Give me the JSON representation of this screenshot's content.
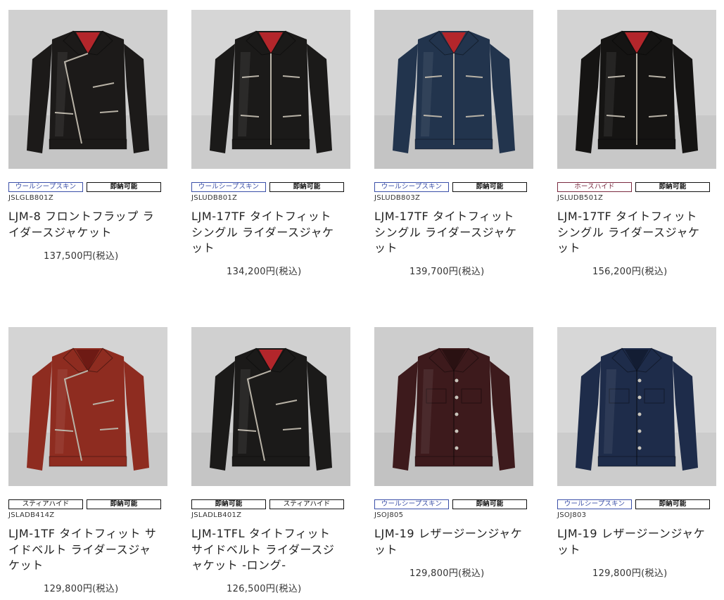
{
  "products": [
    {
      "tag1": "ウールシープスキン",
      "tag2": "即納可能",
      "sku": "JSLGLB801Z",
      "title": "LJM-8 フロントフラップ ライダースジャケット",
      "price": "137,500円(税込)",
      "jacket_color": "#1c1a19",
      "lining_color": "#b3262b",
      "photo_bg": "#d0d0d0"
    },
    {
      "tag1": "ウールシープスキン",
      "tag2": "即納可能",
      "sku": "JSLUDB801Z",
      "title": "LJM-17TF タイトフィット シングル ライダースジャケット",
      "price": "134,200円(税込)",
      "jacket_color": "#1b1a19",
      "lining_color": "#b3262b",
      "photo_bg": "#d6d6d6"
    },
    {
      "tag1": "ウールシープスキン",
      "tag2": "即納可能",
      "sku": "JSLUDB803Z",
      "title": "LJM-17TF タイトフィット シングル ライダースジャケット",
      "price": "139,700円(税込)",
      "jacket_color": "#22344d",
      "lining_color": "#b3262b",
      "photo_bg": "#cfcfcf"
    },
    {
      "tag1": "ホースハイド",
      "tag2": "即納可能",
      "sku": "JSLUDB501Z",
      "title": "LJM-17TF タイトフィット シングル ライダースジャケット",
      "price": "156,200円(税込)",
      "jacket_color": "#151413",
      "lining_color": "#b3262b",
      "photo_bg": "#d3d3d3"
    },
    {
      "tag1": "スティアハイド",
      "tag2": "即納可能",
      "sku": "JSLADB414Z",
      "title": "LJM-1TF タイトフィット サイドベルト ライダースジャケット",
      "price": "129,800円(税込)",
      "jacket_color": "#8e2c20",
      "lining_color": "#6e1a14",
      "photo_bg": "#d4d4d4"
    },
    {
      "tag1": "即納可能",
      "tag2": "スティアハイド",
      "sku": "JSLADLB401Z",
      "title": "LJM-1TFL タイトフィット サイドベルト ライダースジャケット -ロング-",
      "price": "126,500円(税込)",
      "jacket_color": "#1b1a19",
      "lining_color": "#b3262b",
      "photo_bg": "#d0d0d0"
    },
    {
      "tag1": "ウールシープスキン",
      "tag2": "即納可能",
      "sku": "JSOJ805",
      "title": "LJM-19 レザージーンジャケット",
      "price": "129,800円(税込)",
      "jacket_color": "#3d1a1c",
      "lining_color": "#2a1112",
      "photo_bg": "#cdcdcd"
    },
    {
      "tag1": "ウールシープスキン",
      "tag2": "即納可能",
      "sku": "JSOJ803",
      "title": "LJM-19 レザージーンジャケット",
      "price": "129,800円(税込)",
      "jacket_color": "#1e2c4a",
      "lining_color": "#131d33",
      "photo_bg": "#d7d7d7"
    }
  ]
}
